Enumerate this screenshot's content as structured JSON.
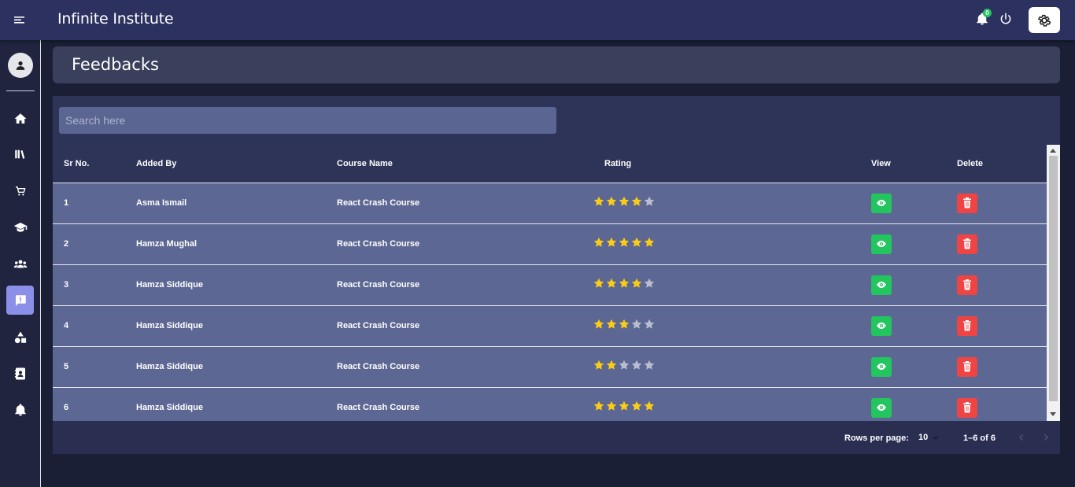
{
  "app": {
    "title": "Infinite Institute",
    "notification_count": "0"
  },
  "page": {
    "title": "Feedbacks"
  },
  "search": {
    "placeholder": "Search here",
    "value": ""
  },
  "sidebar": {
    "items": [
      {
        "icon": "home-icon"
      },
      {
        "icon": "library-icon"
      },
      {
        "icon": "cart-icon"
      },
      {
        "icon": "graduation-cap-icon"
      },
      {
        "icon": "users-icon"
      },
      {
        "icon": "feedback-icon",
        "active": true
      },
      {
        "icon": "shapes-icon"
      },
      {
        "icon": "contacts-icon"
      },
      {
        "icon": "bell-icon"
      }
    ]
  },
  "table": {
    "columns": [
      "Sr No.",
      "Added By",
      "Course Name",
      "Rating",
      "View",
      "Delete"
    ],
    "rows": [
      {
        "sr": "1",
        "added_by": "Asma Ismail",
        "course": "React Crash Course",
        "rating": 4
      },
      {
        "sr": "2",
        "added_by": "Hamza Mughal",
        "course": "React Crash Course",
        "rating": 5
      },
      {
        "sr": "3",
        "added_by": "Hamza Siddique",
        "course": "React Crash Course",
        "rating": 4
      },
      {
        "sr": "4",
        "added_by": "Hamza Siddique",
        "course": "React Crash Course",
        "rating": 3
      },
      {
        "sr": "5",
        "added_by": "Hamza Siddique",
        "course": "React Crash Course",
        "rating": 2
      },
      {
        "sr": "6",
        "added_by": "Hamza Siddique",
        "course": "React Crash Course",
        "rating": 5
      }
    ]
  },
  "pagination": {
    "rows_label": "Rows per page:",
    "rows_value": "10",
    "range": "1–6 of 6"
  },
  "colors": {
    "topbar": "#2c3160",
    "star_filled": "#facc15",
    "star_empty": "#b8bdd0",
    "view": "#22c55e",
    "delete": "#ef4444",
    "active_nav": "#8b8fe8"
  }
}
